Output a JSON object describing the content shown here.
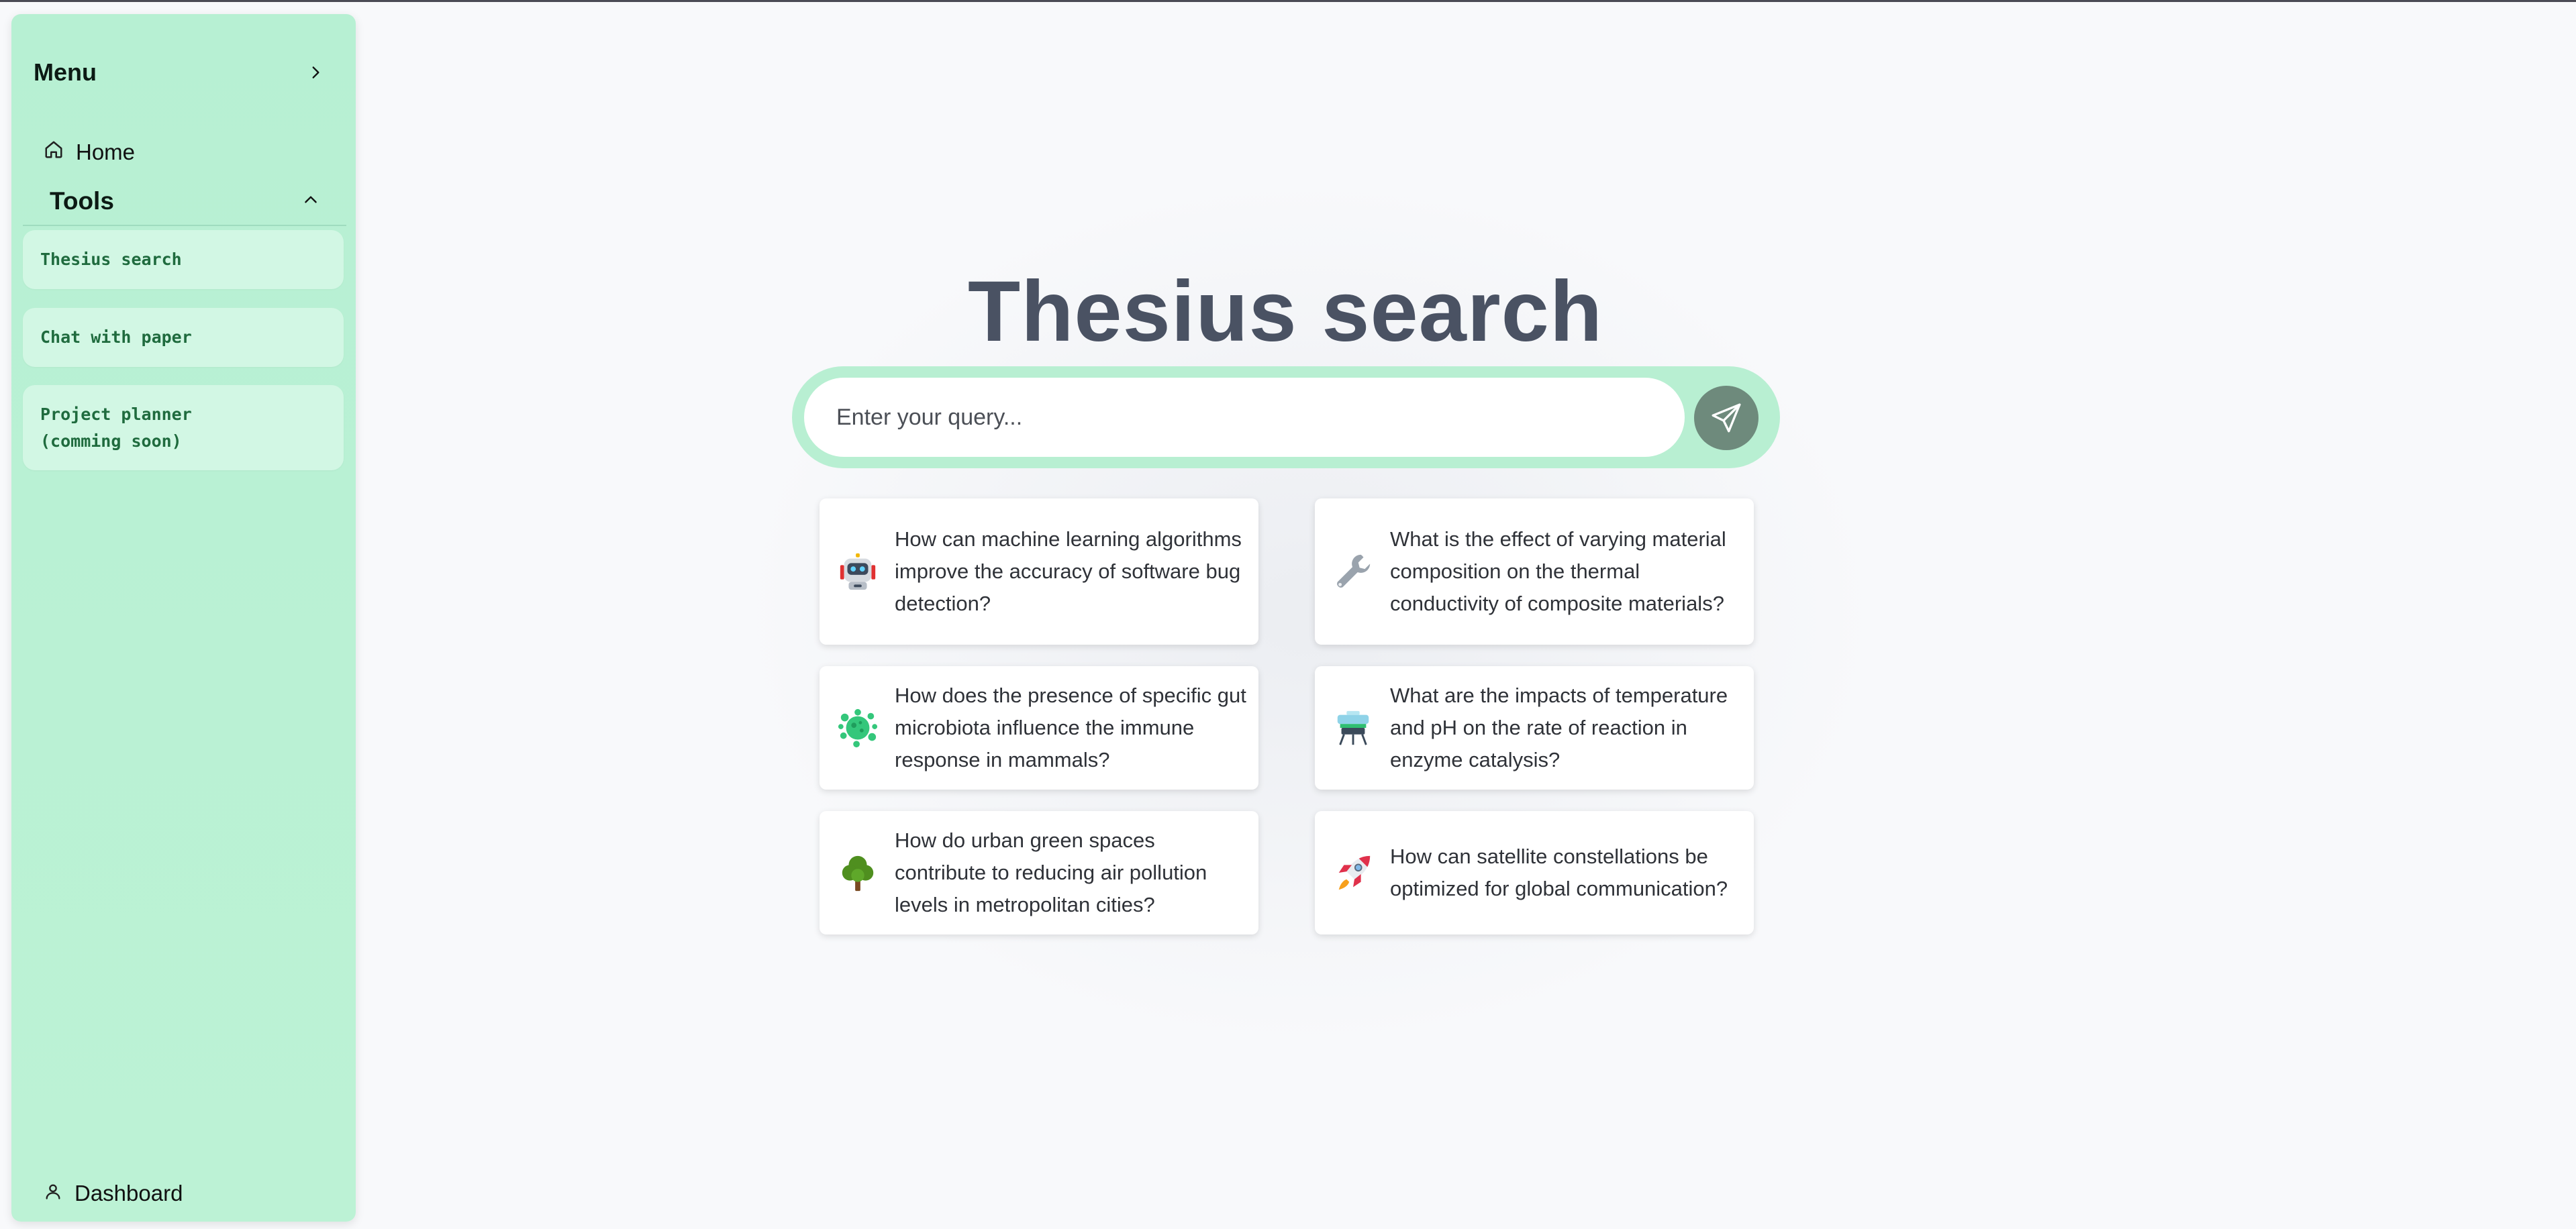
{
  "sidebar": {
    "menu_title": "Menu",
    "home_label": "Home",
    "tools_title": "Tools",
    "tools": [
      {
        "label": "Thesius search"
      },
      {
        "label": "Chat with paper"
      },
      {
        "label": "Project planner\n(comming soon)"
      }
    ],
    "dashboard_label": "Dashboard"
  },
  "main": {
    "title": "Thesius search",
    "search": {
      "placeholder": "Enter your query...",
      "value": ""
    },
    "suggestions": [
      {
        "icon": "robot-icon",
        "text": "How can machine learning algorithms improve the accuracy of software bug detection?"
      },
      {
        "icon": "wrench-icon",
        "text": "What is the effect of varying material composition on the thermal conductivity of composite materials?"
      },
      {
        "icon": "microbe-icon",
        "text": "How does the presence of specific gut microbiota influence the immune response in mammals?"
      },
      {
        "icon": "beaker-icon",
        "text": "What are the impacts of temperature and pH on the rate of reaction in enzyme catalysis?"
      },
      {
        "icon": "tree-icon",
        "text": "How do urban green spaces contribute to reducing air pollution levels in metropolitan cities?"
      },
      {
        "icon": "rocket-icon",
        "text": "How can satellite constellations be optimized for global communication?"
      }
    ]
  },
  "colors": {
    "sidebar_bg": "#b7f0d3",
    "tool_item_bg": "#d2f7e4",
    "tool_item_text": "#1f6b3e",
    "title_text": "#4a5263",
    "search_ring": "#b8efd2",
    "send_button": "#6e8a7c",
    "page_bg": "#f8f9fb"
  }
}
